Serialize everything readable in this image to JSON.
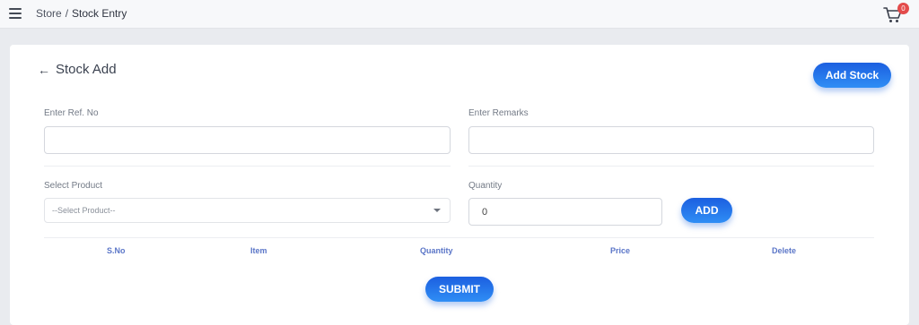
{
  "breadcrumb": {
    "parent": "Store",
    "separator": "/",
    "current": "Stock Entry"
  },
  "cart": {
    "count": "0"
  },
  "form": {
    "title": "Stock Add",
    "add_stock_label": "Add Stock",
    "ref_label": "Enter Ref. No",
    "ref_value": "",
    "remarks_label": "Enter Remarks",
    "remarks_value": "",
    "product_label": "Select Product",
    "product_selected": "--Select Product--",
    "quantity_label": "Quantity",
    "quantity_value": "0",
    "add_label": "ADD",
    "submit_label": "SUBMIT"
  },
  "table": {
    "columns": [
      "S.No",
      "Item",
      "Quantity",
      "Price",
      "Delete"
    ],
    "rows": []
  },
  "colors": {
    "accent": "#2f8ef5",
    "accent_dark": "#1c5fe0",
    "badge": "#e34b4b",
    "table_header": "#5b76c8"
  },
  "icons": {
    "menu": "hamburger-icon",
    "cart": "cart-icon",
    "back": "back-arrow-icon",
    "dropdown": "chevron-down-icon"
  }
}
